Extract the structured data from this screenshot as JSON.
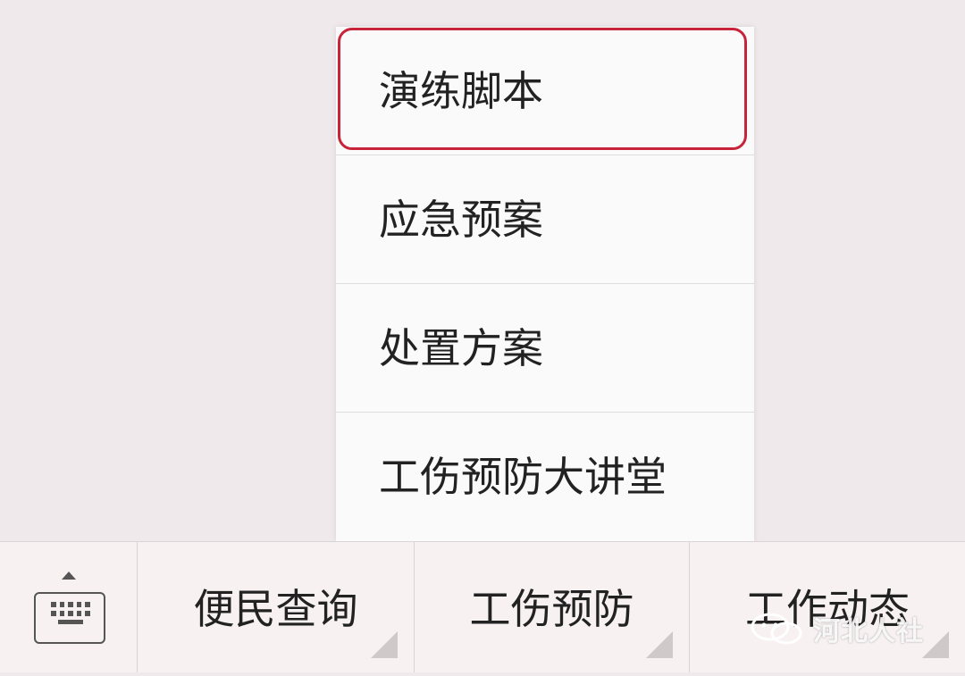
{
  "popup_menu": {
    "items": [
      {
        "label": "演练脚本",
        "selected": true
      },
      {
        "label": "应急预案",
        "selected": false
      },
      {
        "label": "处置方案",
        "selected": false
      },
      {
        "label": "工伤预防大讲堂",
        "selected": false
      }
    ],
    "highlight_color": "#c7243a"
  },
  "bottom_bar": {
    "keyboard_icon": "keyboard-icon",
    "caret_icon": "caret-up-icon",
    "buttons": [
      {
        "label": "便民查询",
        "icon": "submenu-corner-icon"
      },
      {
        "label": "工伤预防",
        "icon": "submenu-corner-icon"
      },
      {
        "label": "工作动态",
        "icon": "submenu-corner-icon"
      }
    ]
  },
  "watermark": {
    "icon": "wechat-icon",
    "text": "河北人社"
  }
}
